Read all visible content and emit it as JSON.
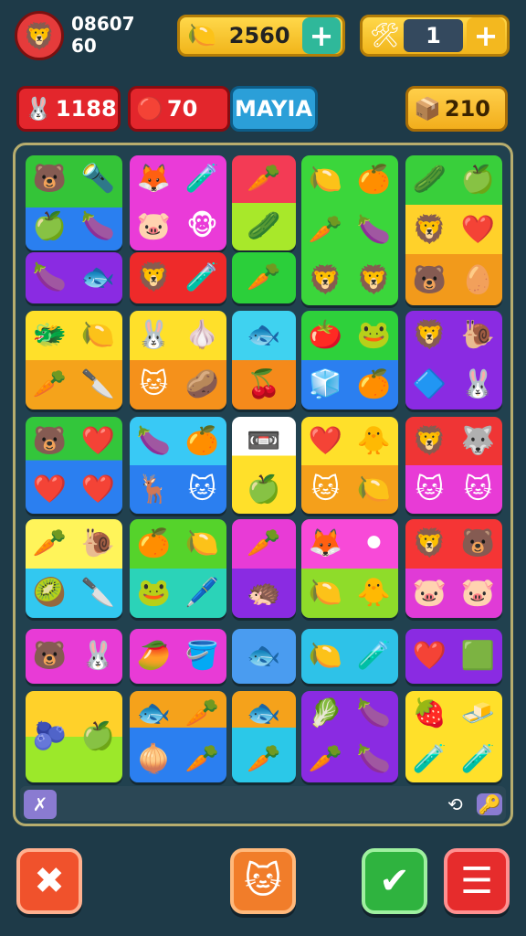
{
  "player": {
    "line1": "08607",
    "line2": "60",
    "avatar_icon": "lion-face-icon"
  },
  "coins": {
    "value": "2560",
    "add_label": "+",
    "icon": "fruit-icon"
  },
  "boosters": {
    "value": "1",
    "add_label": "+",
    "icon": "crafting-tools-icon"
  },
  "stats": {
    "lives": {
      "value": "1188",
      "icon": "bunny-face-icon"
    },
    "moves": {
      "value": "70",
      "icon": "red-orb-icon"
    },
    "name": "MAYIA",
    "gold": {
      "value": "210",
      "icon": "treasure-chest-icon"
    }
  },
  "board": {
    "tiles": [
      {
        "bg": "linear-gradient(#34c438 55%,#2a7ff0 55%)",
        "items": [
          "🐻",
          "🔦",
          "🍏",
          "🍆"
        ]
      },
      {
        "bg": "#ea3bd8",
        "items": [
          "🦊",
          "🧪",
          "🐷",
          "🐵"
        ]
      },
      {
        "bg": "linear-gradient(#f33b55 50%,#a8e82a 50%)",
        "items": [
          "🥕",
          "🥒"
        ]
      },
      {
        "bg": "#3bd63b",
        "items": [
          "🍋",
          "🍊",
          "🥕",
          "🍆",
          "🦁",
          "🦁"
        ]
      },
      {
        "bg": "linear-gradient(#39cf3b 33%,#ffd12a 33%,#ffd12a 66%,#f29a1b 66%)",
        "items": [
          "🥒",
          "🍏",
          "🦁",
          "❤️",
          "🐻",
          "🥚"
        ]
      },
      {
        "bg": "#8a2be2",
        "items": [
          "🍆",
          "🐟"
        ]
      },
      {
        "bg": "#ee2a2a",
        "items": [
          "🦁",
          "🧪"
        ]
      },
      {
        "bg": "#2bcf3a",
        "items": [
          "🥕"
        ]
      },
      {
        "bg": "linear-gradient(#ffe02a 50%,#f5a31b 50%)",
        "items": [
          "🐲",
          "🍋",
          "🥕",
          "🔪"
        ]
      },
      {
        "bg": "linear-gradient(#ffe02a 50%,#f5911b 50%)",
        "items": [
          "🐰",
          "🧄",
          "🐱",
          "🥔"
        ]
      },
      {
        "bg": "linear-gradient(#3fd2f0 50%,#f58a1b 50%)",
        "items": [
          "🐟",
          "🍒"
        ]
      },
      {
        "bg": "linear-gradient(#2ed13b 50%,#2b7ff0 50%)",
        "items": [
          "🍅",
          "🐸",
          "🧊",
          "🍊"
        ]
      },
      {
        "bg": "#8a2be2",
        "items": [
          "🦁",
          "🐌",
          "🔷",
          "🐰"
        ]
      },
      {
        "bg": "linear-gradient(#33c63b 45%,#2b7ff0 45%)",
        "items": [
          "🐻",
          "❤️",
          "❤️",
          "❤️"
        ]
      },
      {
        "bg": "linear-gradient(#39c9f5 50%,#2b7ff0 50%)",
        "items": [
          "🍆",
          "🍊",
          "🦌",
          "🐱"
        ]
      },
      {
        "bg": "linear-gradient(#fff 40%,#ffe02a 40%)",
        "items": [
          "📼",
          "🍏"
        ]
      },
      {
        "bg": "linear-gradient(#ffe02a 50%,#f5a01b 50%)",
        "items": [
          "❤️",
          "🐥",
          "🐱",
          "🍋"
        ]
      },
      {
        "bg": "linear-gradient(#ef3535 50%,#e83bd6 50%)",
        "items": [
          "🦁",
          "🐺",
          "🐱",
          "🐱"
        ]
      },
      {
        "bg": "linear-gradient(#fff45a 50%,#32c8f0 50%)",
        "items": [
          "🥕",
          "🐌",
          "🥝",
          "🔪"
        ]
      },
      {
        "bg": "linear-gradient(#55d32b 50%,#2bd3b8 50%)",
        "items": [
          "🍊",
          "🍋",
          "🐸",
          "🖊️"
        ]
      },
      {
        "bg": "linear-gradient(#e83bd6 50%,#8a2be2 50%)",
        "items": [
          "🥕",
          "🦔"
        ]
      },
      {
        "bg": "linear-gradient(#f84ad8 50%,#8fdc2a 50%)",
        "items": [
          "🦊",
          "⚫",
          "🍋",
          "🐥"
        ]
      },
      {
        "bg": "linear-gradient(#f53535 50%,#e03bd6 50%)",
        "items": [
          "🦁",
          "🐻",
          "🐷",
          "🐷"
        ]
      },
      {
        "bg": "#e83bd6",
        "items": [
          "🐻",
          "🐰"
        ]
      },
      {
        "bg": "#e83bd6",
        "items": [
          "🥭",
          "🪣"
        ]
      },
      {
        "bg": "#4a9cf0",
        "items": [
          "🐟"
        ]
      },
      {
        "bg": "#2ec2e8",
        "items": [
          "🍋",
          "🧪"
        ]
      },
      {
        "bg": "#8a2be2",
        "items": [
          "❤️",
          "🟩"
        ]
      },
      {
        "bg": "linear-gradient(#ffd12a 50%,#9ce82a 50%)",
        "items": [
          "🫐",
          "🍏"
        ]
      },
      {
        "bg": "linear-gradient(#f5a21b 40%,#2b7ff0 40%)",
        "items": [
          "🐟",
          "🥕",
          "🧅",
          "🥕"
        ]
      },
      {
        "bg": "linear-gradient(#f5a21b 40%,#2bc8e8 40%)",
        "items": [
          "🐟",
          "🥕"
        ]
      },
      {
        "bg": "#8a2be2",
        "items": [
          "🥬",
          "🍆",
          "🥕",
          "🍆"
        ]
      },
      {
        "bg": "#ffe02a",
        "items": [
          "🍓",
          "🧈",
          "🧪",
          "🧪"
        ]
      }
    ]
  },
  "buttons": {
    "close": {
      "label": "✖"
    },
    "pet": {
      "label": "🐱"
    },
    "confirm": {
      "label": "✔"
    },
    "menu": {
      "label": "☰"
    }
  },
  "tray": {
    "left_icon": "✗",
    "refresh_icon": "⟲",
    "key_icon": "🔑"
  }
}
